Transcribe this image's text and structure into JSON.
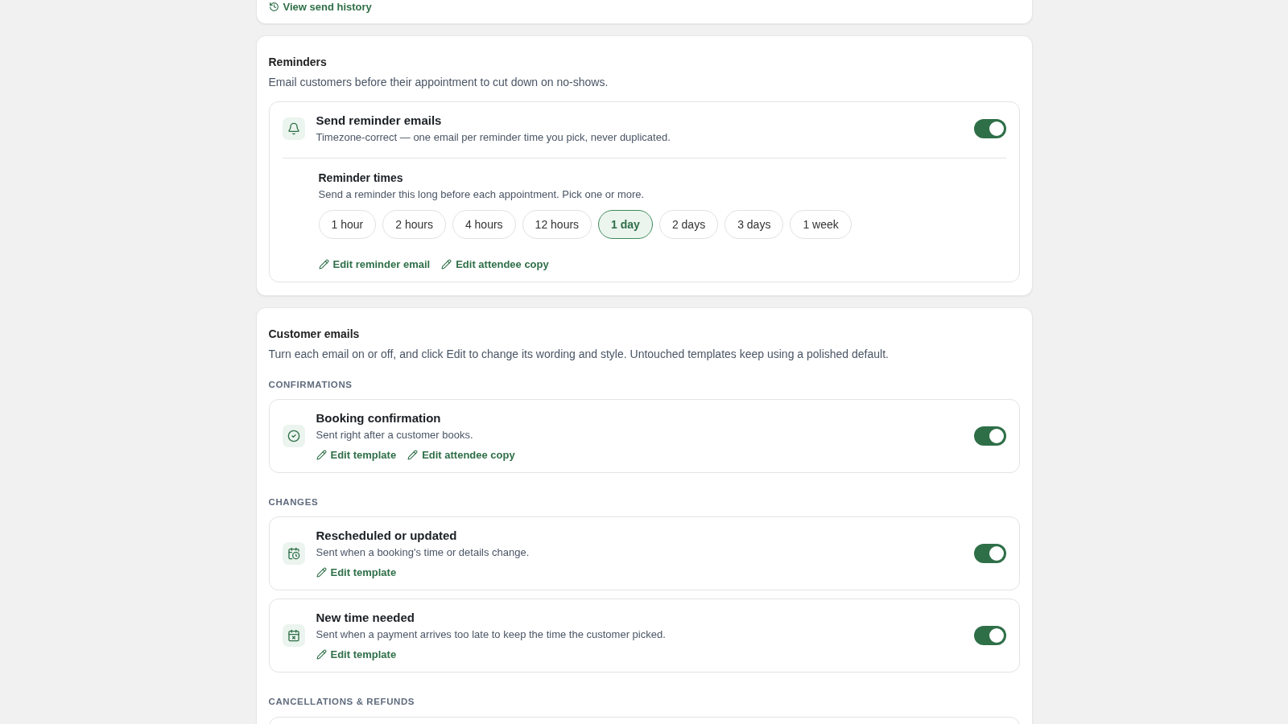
{
  "history_card": {
    "link": "View send history"
  },
  "reminders": {
    "title": "Reminders",
    "description": "Email customers before their appointment to cut down on no-shows.",
    "setting": {
      "title": "Send reminder emails",
      "description": "Timezone-correct — one email per reminder time you pick, never duplicated.",
      "on": true
    },
    "times": {
      "title": "Reminder times",
      "description": "Send a reminder this long before each appointment. Pick one or more.",
      "options": [
        {
          "label": "1 hour",
          "selected": false
        },
        {
          "label": "2 hours",
          "selected": false
        },
        {
          "label": "4 hours",
          "selected": false
        },
        {
          "label": "12 hours",
          "selected": false
        },
        {
          "label": "1 day",
          "selected": true
        },
        {
          "label": "2 days",
          "selected": false
        },
        {
          "label": "3 days",
          "selected": false
        },
        {
          "label": "1 week",
          "selected": false
        }
      ]
    },
    "links": [
      "Edit reminder email",
      "Edit attendee copy"
    ]
  },
  "customer_emails": {
    "title": "Customer emails",
    "description": "Turn each email on or off, and click Edit to change its wording and style. Untouched templates keep using a polished default.",
    "groups": [
      {
        "heading": "CONFIRMATIONS",
        "items": [
          {
            "kind": "confirmed",
            "title": "Booking confirmation",
            "description": "Sent right after a customer books.",
            "on": true,
            "links": [
              "Edit template",
              "Edit attendee copy"
            ]
          }
        ]
      },
      {
        "heading": "CHANGES",
        "items": [
          {
            "kind": "rescheduled",
            "title": "Rescheduled or updated",
            "description": "Sent when a booking's time or details change.",
            "on": true,
            "links": [
              "Edit template"
            ]
          },
          {
            "kind": "expired",
            "title": "New time needed",
            "description": "Sent when a payment arrives too late to keep the time the customer picked.",
            "on": true,
            "links": [
              "Edit template"
            ]
          }
        ]
      },
      {
        "heading": "CANCELLATIONS & REFUNDS"
      }
    ]
  }
}
